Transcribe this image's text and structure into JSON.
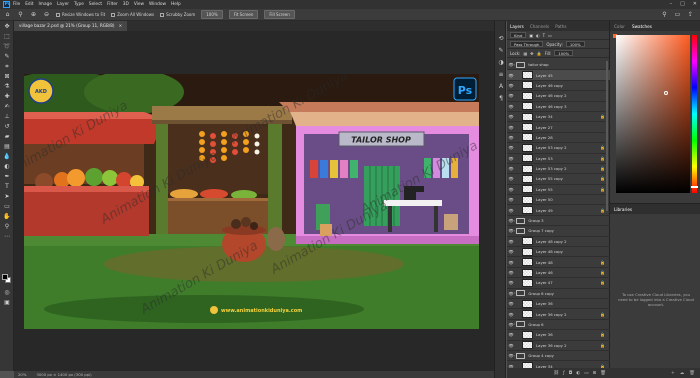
{
  "menubar": {
    "items": [
      "File",
      "Edit",
      "Image",
      "Layer",
      "Type",
      "Select",
      "Filter",
      "3D",
      "View",
      "Window",
      "Help"
    ],
    "ps_badge": "Ps"
  },
  "options": {
    "resize_label": "Resize Windows to Fit",
    "zoom_all_label": "Zoom All Windows",
    "scrubby_label": "Scrubby Zoom",
    "zoom_pct": "100%",
    "fit_screen": "Fit Screen",
    "fill_screen": "Fill Screen"
  },
  "document": {
    "tab_label": "village bazar 2.psd @ 21% (Group 11, RGB/8)",
    "close_glyph": "×"
  },
  "artwork": {
    "shop_sign": "TAILOR SHOP",
    "watermark": "Animation Ki Duniya",
    "url": "www.animationkiduniya.com",
    "ps_badge": "Ps",
    "logo_text": "AKD"
  },
  "status": {
    "zoom": "20%",
    "size": "3000 px × 1400 px (300 ppi)"
  },
  "layers_panel": {
    "tabs": [
      "Layers",
      "Channels",
      "Paths"
    ],
    "kind_label": "Kind",
    "blend_mode": "Pass Through",
    "opacity_label": "Opacity:",
    "opacity_value": "100%",
    "lock_label": "Lock:",
    "fill_label": "Fill:",
    "fill_value": "100%",
    "rows": [
      {
        "name": "tailor shop",
        "type": "group",
        "locked": false,
        "selected": false
      },
      {
        "name": "Layer 45",
        "type": "layer",
        "locked": false,
        "selected": true
      },
      {
        "name": "Layer 46 copy",
        "type": "layer",
        "locked": false,
        "selected": false
      },
      {
        "name": "Layer 46 copy 2",
        "type": "layer",
        "locked": false,
        "selected": false
      },
      {
        "name": "Layer 46 copy 3",
        "type": "layer",
        "locked": false,
        "selected": false
      },
      {
        "name": "Layer 34",
        "type": "layer",
        "locked": true,
        "selected": false
      },
      {
        "name": "Layer 27",
        "type": "layer",
        "locked": false,
        "selected": false
      },
      {
        "name": "Layer 28",
        "type": "layer",
        "locked": false,
        "selected": false
      },
      {
        "name": "Layer 53 copy 2",
        "type": "layer",
        "locked": true,
        "selected": false
      },
      {
        "name": "Layer 53",
        "type": "layer",
        "locked": true,
        "selected": false
      },
      {
        "name": "Layer 53 copy 2",
        "type": "layer",
        "locked": true,
        "selected": false
      },
      {
        "name": "Layer 55 copy",
        "type": "layer",
        "locked": true,
        "selected": false
      },
      {
        "name": "Layer 55",
        "type": "layer",
        "locked": true,
        "selected": false
      },
      {
        "name": "Layer 50",
        "type": "layer",
        "locked": false,
        "selected": false
      },
      {
        "name": "Layer 49",
        "type": "layer",
        "locked": true,
        "selected": false
      },
      {
        "name": "Group 3",
        "type": "group",
        "locked": false,
        "selected": false
      },
      {
        "name": "Group 7 copy",
        "type": "group",
        "locked": false,
        "selected": false
      },
      {
        "name": "Layer 48 copy 2",
        "type": "layer",
        "locked": false,
        "selected": false
      },
      {
        "name": "Layer 48 copy",
        "type": "layer",
        "locked": false,
        "selected": false
      },
      {
        "name": "Layer 48",
        "type": "layer",
        "locked": true,
        "selected": false
      },
      {
        "name": "Layer 46",
        "type": "layer",
        "locked": true,
        "selected": false
      },
      {
        "name": "Layer 47",
        "type": "layer",
        "locked": true,
        "selected": false
      },
      {
        "name": "Group 6 copy",
        "type": "group",
        "locked": false,
        "selected": false
      },
      {
        "name": "Layer 36",
        "type": "layer",
        "locked": false,
        "selected": false
      },
      {
        "name": "Layer 36 copy 2",
        "type": "layer",
        "locked": true,
        "selected": false
      },
      {
        "name": "Group 6",
        "type": "group",
        "locked": false,
        "selected": false
      },
      {
        "name": "Layer 36",
        "type": "layer",
        "locked": true,
        "selected": false
      },
      {
        "name": "Layer 36 copy 2",
        "type": "layer",
        "locked": true,
        "selected": false
      },
      {
        "name": "Group 4 copy",
        "type": "group",
        "locked": false,
        "selected": false
      },
      {
        "name": "Layer 34",
        "type": "layer",
        "locked": true,
        "selected": false
      }
    ]
  },
  "color_panel": {
    "tabs": [
      "Color",
      "Swatches"
    ],
    "foreground_hex": "#ff6a32"
  },
  "libraries_panel": {
    "title": "Libraries",
    "message": "To use Creative Cloud Libraries, you need to be logged into a Creative Cloud account."
  },
  "colors": {
    "ui_dark": "#323232",
    "panel": "#3b3b3b",
    "ps_blue": "#31a8ff",
    "shop_pink": "#e58ce0",
    "grass": "#3f7d2a"
  }
}
